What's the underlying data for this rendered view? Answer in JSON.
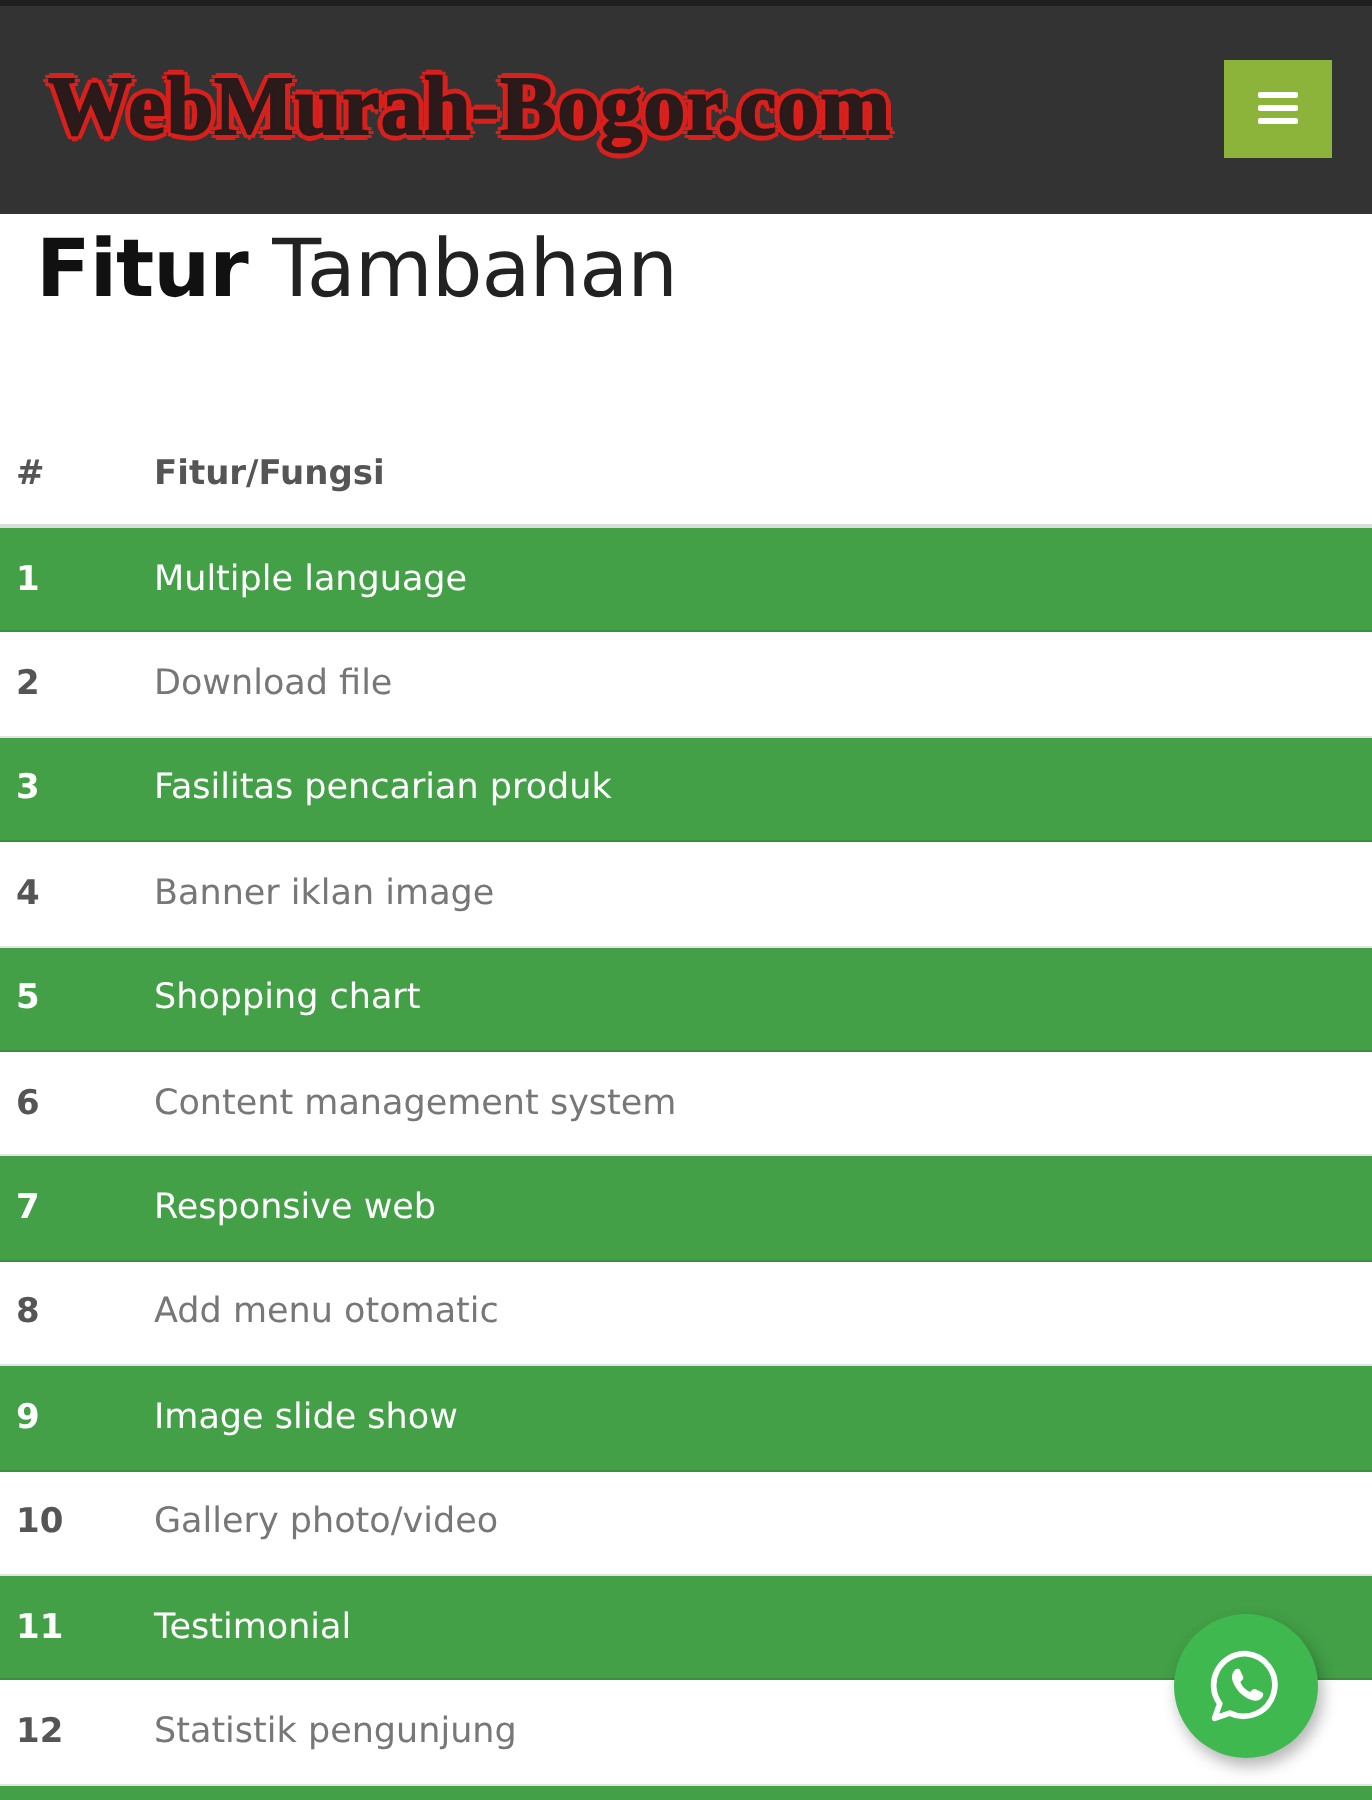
{
  "header": {
    "logo": "WebMurah-Bogor.com"
  },
  "title": "**Fitur** Tambahan",
  "table": {
    "columns": [
      "#",
      "Fitur/Fungsi"
    ],
    "rows": [
      {
        "number": "1",
        "feature": "Multiple language",
        "highlighted": true
      },
      {
        "number": "2",
        "feature": "Download file",
        "highlighted": false
      },
      {
        "number": "3",
        "feature": "Fasilitas pencarian produk",
        "highlighted": true
      },
      {
        "number": "4",
        "feature": "Banner iklan image",
        "highlighted": false
      },
      {
        "number": "5",
        "feature": "Shopping chart",
        "highlighted": true
      },
      {
        "number": "6",
        "feature": "Content management system",
        "highlighted": false
      },
      {
        "number": "7",
        "feature": "Responsive web",
        "highlighted": true
      },
      {
        "number": "8",
        "feature": "Add menu otomatic",
        "highlighted": false
      },
      {
        "number": "9",
        "feature": "Image slide show",
        "highlighted": true
      },
      {
        "number": "10",
        "feature": "Gallery photo/video",
        "highlighted": false
      },
      {
        "number": "11",
        "feature": "Testimonial",
        "highlighted": true
      },
      {
        "number": "12",
        "feature": "Statistik pengunjung",
        "highlighted": false
      }
    ],
    "cut_off_row": {
      "highlighted": true
    }
  }
}
